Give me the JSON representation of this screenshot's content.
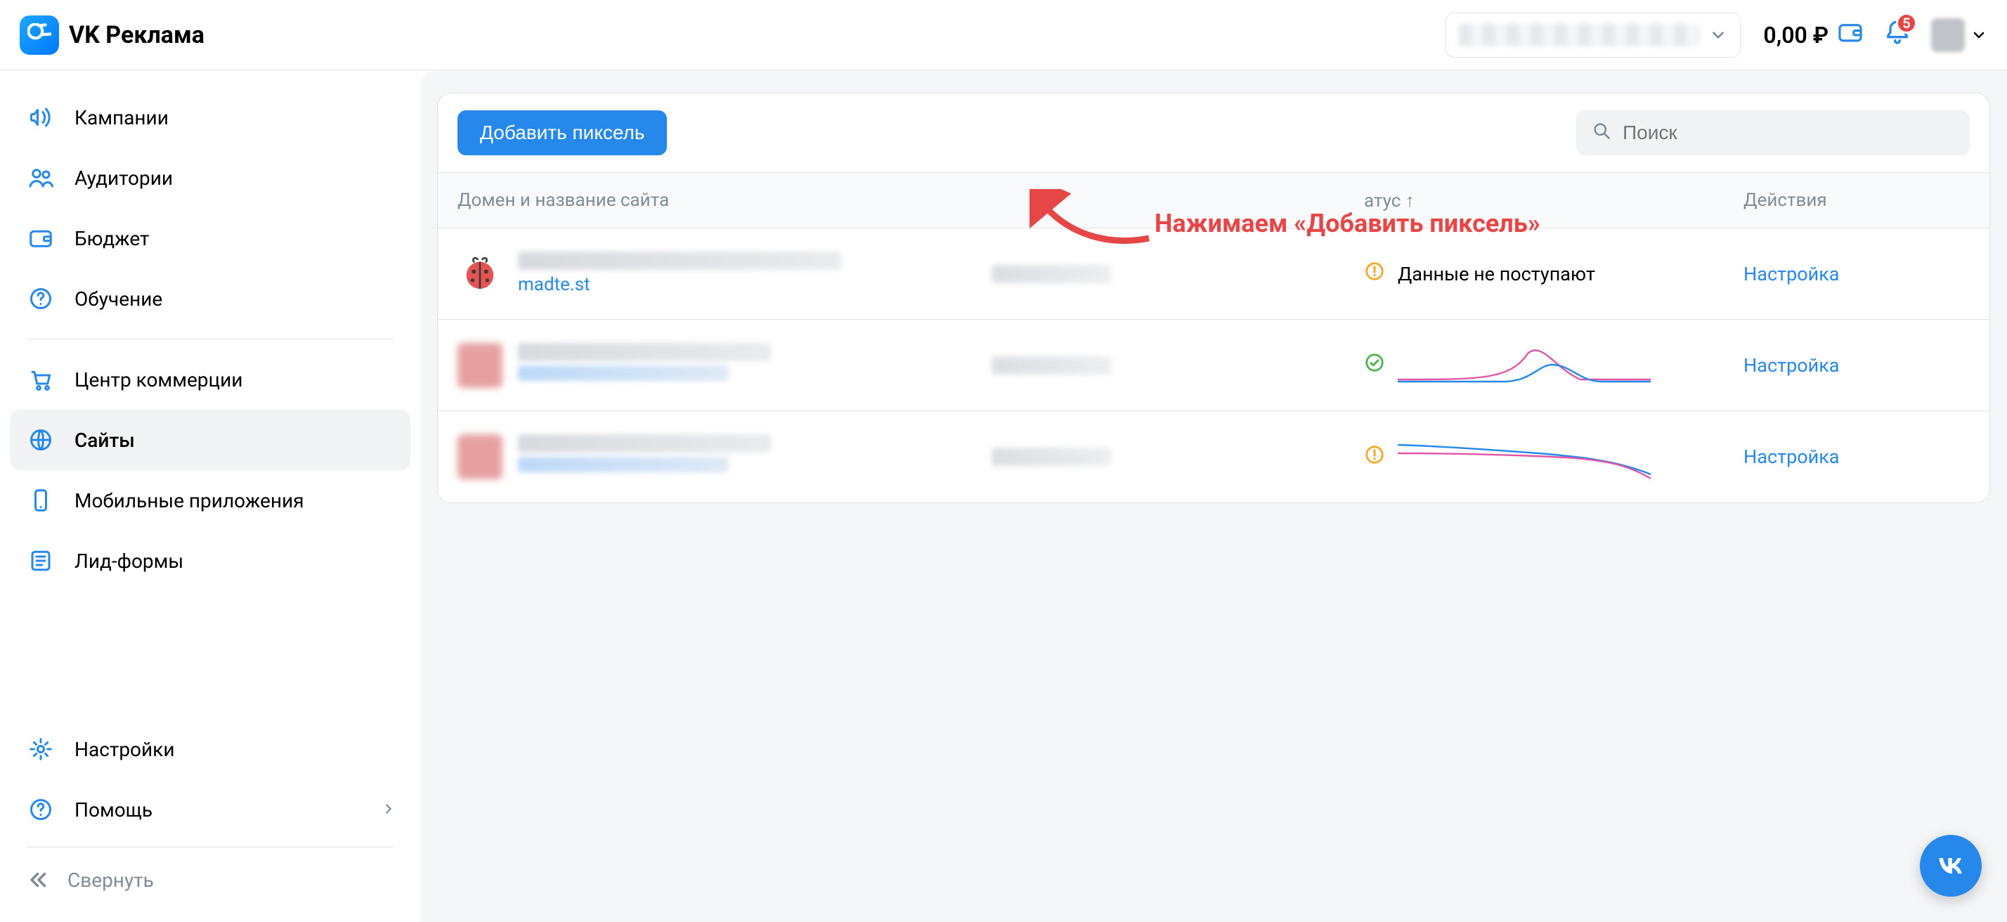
{
  "header": {
    "brand": "VK Реклама",
    "balance": "0,00 ₽",
    "notification_count": "5"
  },
  "sidebar": {
    "items": [
      {
        "id": "campaigns",
        "label": "Кампании",
        "icon": "megaphone"
      },
      {
        "id": "audiences",
        "label": "Аудитории",
        "icon": "users"
      },
      {
        "id": "budget",
        "label": "Бюджет",
        "icon": "wallet"
      },
      {
        "id": "learning",
        "label": "Обучение",
        "icon": "help-circle"
      }
    ],
    "items2": [
      {
        "id": "commerce",
        "label": "Центр коммерции",
        "icon": "cart"
      },
      {
        "id": "sites",
        "label": "Сайты",
        "icon": "globe",
        "active": true
      },
      {
        "id": "apps",
        "label": "Мобильные приложения",
        "icon": "phone"
      },
      {
        "id": "leadforms",
        "label": "Лид-формы",
        "icon": "form"
      }
    ],
    "items3": [
      {
        "id": "settings",
        "label": "Настройки",
        "icon": "gear"
      },
      {
        "id": "help",
        "label": "Помощь",
        "icon": "help-circle",
        "chevron": true
      }
    ],
    "collapse_label": "Свернуть"
  },
  "toolbar": {
    "add_pixel_label": "Добавить пиксель",
    "search_placeholder": "Поиск"
  },
  "annotation_text": "Нажимаем «Добавить пиксель»",
  "table": {
    "headers": {
      "domain": "Домен и название сайта",
      "status": "атус ↑",
      "actions": "Действия"
    },
    "rows": [
      {
        "favicon": "ladybug",
        "link": "madte.st",
        "status_icon": "warn",
        "status_text": "Данные не поступают",
        "spark": null,
        "action_label": "Настройка"
      },
      {
        "favicon": "blur",
        "link": null,
        "status_icon": "ok",
        "status_text": "",
        "spark": "peak",
        "action_label": "Настройка"
      },
      {
        "favicon": "blur",
        "link": null,
        "status_icon": "warn",
        "status_text": "",
        "spark": "decline",
        "action_label": "Настройка"
      }
    ]
  }
}
